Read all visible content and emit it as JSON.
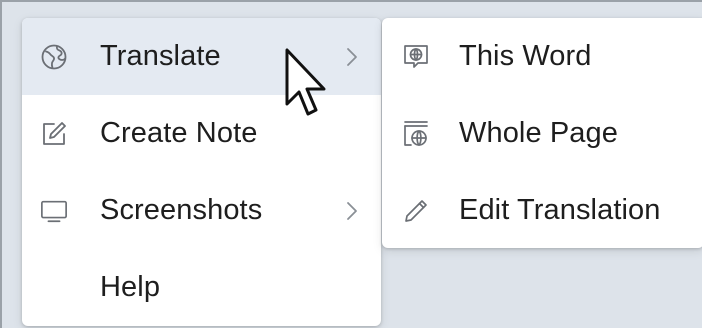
{
  "main_menu": {
    "items": [
      {
        "label": "Translate",
        "icon": "translate-globe-icon",
        "has_submenu": true,
        "highlighted": true
      },
      {
        "label": "Create Note",
        "icon": "note-pencil-icon",
        "has_submenu": false,
        "highlighted": false
      },
      {
        "label": "Screenshots",
        "icon": "monitor-icon",
        "has_submenu": true,
        "highlighted": false
      },
      {
        "label": "Help",
        "icon": "",
        "has_submenu": false,
        "highlighted": false
      }
    ]
  },
  "submenu": {
    "items": [
      {
        "label": "This Word",
        "icon": "word-globe-icon"
      },
      {
        "label": "Whole Page",
        "icon": "page-globe-icon"
      },
      {
        "label": "Edit Translation",
        "icon": "pencil-icon"
      }
    ]
  },
  "colors": {
    "background": "#dde3ea",
    "menu_bg": "#ffffff",
    "highlight": "#e4eaf2",
    "text": "#1e1e1e",
    "icon": "#6b6f75"
  }
}
